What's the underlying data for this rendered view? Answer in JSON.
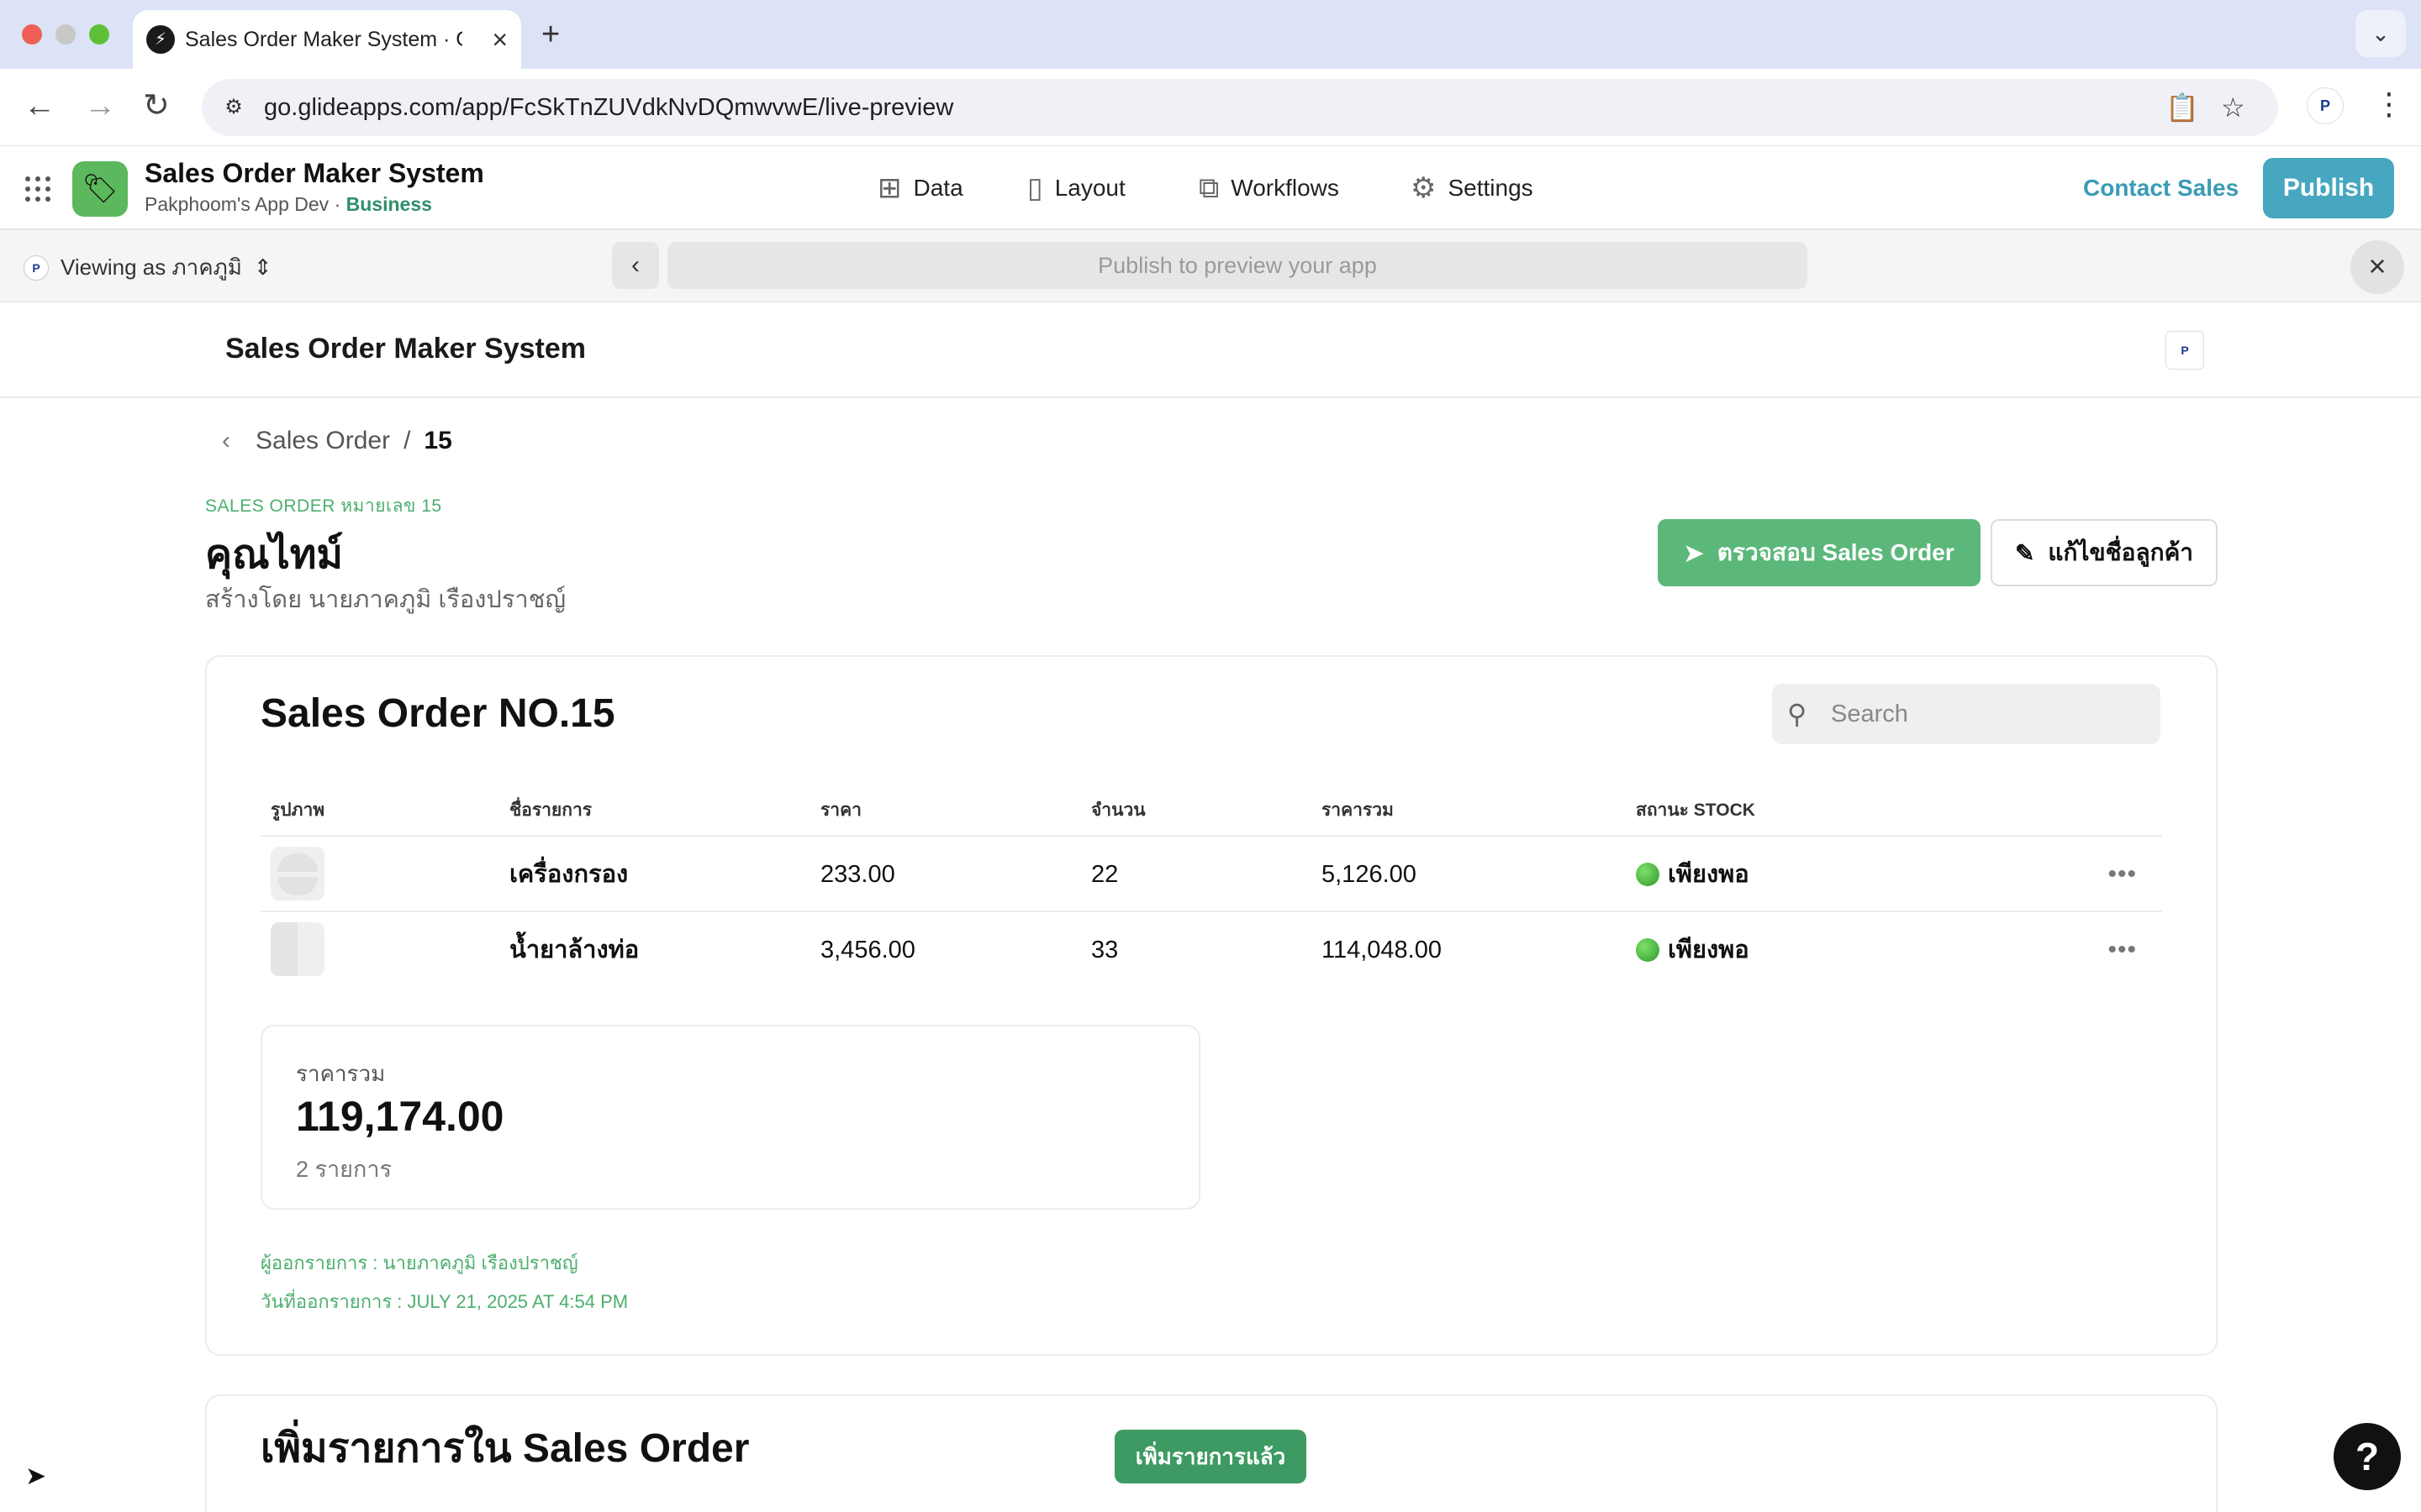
{
  "browser": {
    "tab_title": "Sales Order Maker System · Glide",
    "url": "go.glideapps.com/app/FcSkTnZUVdkNvDQmwvwE/live-preview"
  },
  "glide": {
    "app_name": "Sales Order Maker System",
    "workspace": "Pakphoom's App Dev",
    "separator": "·",
    "plan": "Business",
    "nav": [
      {
        "label": "Data",
        "icon": "data-grid-icon"
      },
      {
        "label": "Layout",
        "icon": "layout-icon"
      },
      {
        "label": "Workflows",
        "icon": "workflows-icon"
      },
      {
        "label": "Settings",
        "icon": "gear-icon"
      }
    ],
    "contact_sales": "Contact Sales",
    "publish": "Publish"
  },
  "preview": {
    "viewing_as": "Viewing as ภาคภูมิ",
    "url_placeholder": "Publish to preview your app"
  },
  "app": {
    "header_title": "Sales Order Maker System",
    "breadcrumb": {
      "parent": "Sales Order",
      "separator": "/",
      "current": "15"
    },
    "eyebrow": "SALES ORDER หมายเลข 15",
    "title": "คุณไทม์",
    "subtitle": "สร้างโดย นายภาคภูมิ เรืองปราชญ์",
    "primary_action": "ตรวจสอบ Sales Order",
    "secondary_action": "แก้ไขชื่อลูกค้า",
    "order_card": {
      "title": "Sales Order NO.15",
      "search_placeholder": "Search",
      "columns": [
        "รูปภาพ",
        "ชื่อรายการ",
        "ราคา",
        "จำนวน",
        "ราคารวม",
        "สถานะ STOCK"
      ],
      "rows": [
        {
          "name": "เครื่องกรอง",
          "price": "233.00",
          "qty": "22",
          "total": "5,126.00",
          "status": "เพียงพอ",
          "status_color": "#3cb043"
        },
        {
          "name": "น้ำยาล้างท่อ",
          "price": "3,456.00",
          "qty": "33",
          "total": "114,048.00",
          "status": "เพียงพอ",
          "status_color": "#3cb043"
        }
      ],
      "summary": {
        "label": "ราคารวม",
        "value": "119,174.00",
        "count": "2 รายการ"
      },
      "issuer": "ผู้ออกรายการ : นายภาคภูมิ เรืองปราชญ์",
      "issued_at": "วันที่ออกรายการ : JULY 21, 2025 AT 4:54 PM"
    },
    "add_card_title": "เพิ่มรายการใน Sales Order",
    "toast": "เพิ่มรายการแล้ว"
  },
  "colors": {
    "accent_green": "#5cb87a",
    "publish_blue": "#47a7c0",
    "label_green": "#4caf6e"
  }
}
